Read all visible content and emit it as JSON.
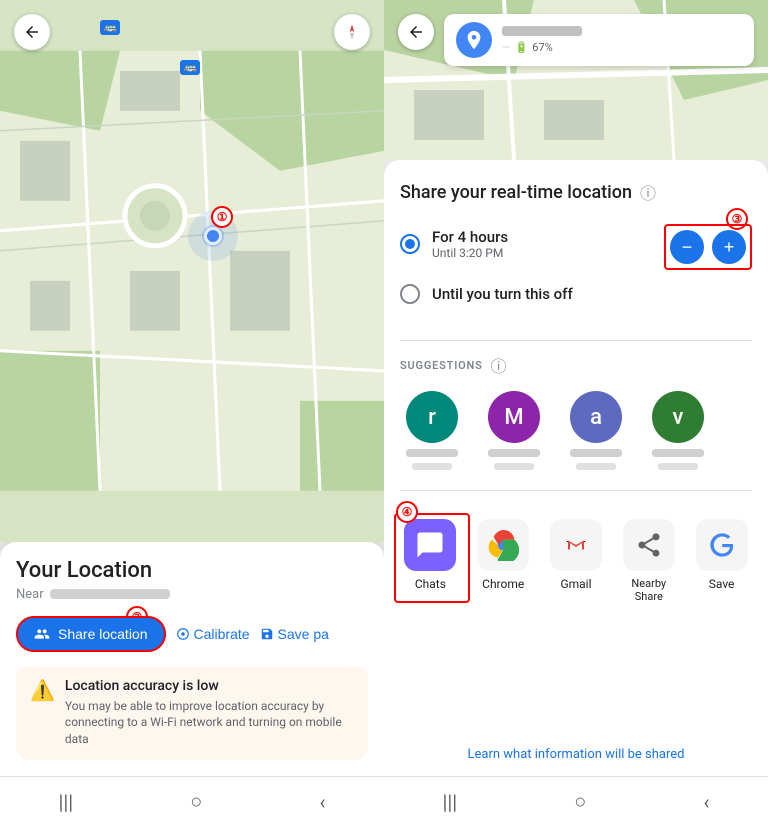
{
  "left": {
    "title": "Your Location",
    "near_label": "Near",
    "step1": "①",
    "step2": "②",
    "share_btn": "Share location",
    "calibrate_btn": "Calibrate",
    "save_btn": "Save pa",
    "accuracy_title": "Location accuracy is low",
    "accuracy_body": "You may be able to improve location accuracy by connecting to a Wi-Fi network and turning on mobile data",
    "nav_icons": [
      "|||",
      "○",
      "<"
    ]
  },
  "right": {
    "back_icon": "←",
    "device_battery": "67%",
    "share_title": "Share your real-time location",
    "step3": "③",
    "step4": "④",
    "duration_option1_main": "For 4 hours",
    "duration_option1_sub": "Until 3:20 PM",
    "duration_option2": "Until you turn this off",
    "suggestions_label": "SUGGESTIONS",
    "contacts": [
      {
        "letter": "r",
        "color": "#00897b"
      },
      {
        "letter": "M",
        "color": "#8e24aa"
      },
      {
        "letter": "a",
        "color": "#5c6bc0"
      },
      {
        "letter": "v",
        "color": "#2e7d32"
      }
    ],
    "apps": [
      {
        "label": "Chats",
        "emoji": "💬",
        "bg": "#7b61ff"
      },
      {
        "label": "Chrome",
        "emoji": "🌐",
        "bg": "transparent"
      },
      {
        "label": "Gmail",
        "emoji": "✉",
        "bg": "transparent"
      },
      {
        "label": "Nearby Share",
        "emoji": "↗",
        "bg": "transparent"
      },
      {
        "label": "Save",
        "emoji": "G",
        "bg": "transparent"
      }
    ],
    "learn_link": "Learn what information will be shared",
    "minus_icon": "−",
    "plus_icon": "+",
    "nav_icons": [
      "|||",
      "○",
      "<"
    ]
  }
}
